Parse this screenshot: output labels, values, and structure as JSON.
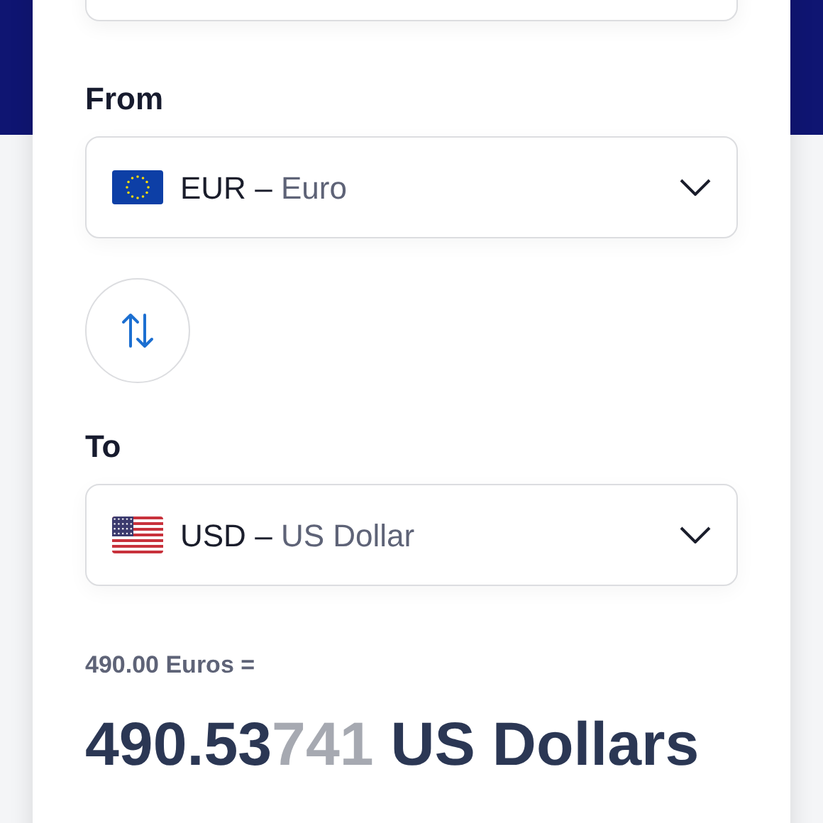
{
  "from": {
    "label": "From",
    "select": {
      "flag": {
        "kind": "eu"
      },
      "code": "EUR",
      "separator": "–",
      "name": "Euro"
    }
  },
  "swap": {
    "kind": "arrows"
  },
  "to": {
    "label": "To",
    "select": {
      "flag": {
        "kind": "us"
      },
      "code": "USD",
      "separator": "–",
      "name": "US Dollar"
    }
  },
  "result": {
    "input_line": "490.00 Euros =",
    "main": "490.53",
    "faded": "741",
    "unit": "US Dollars"
  }
}
